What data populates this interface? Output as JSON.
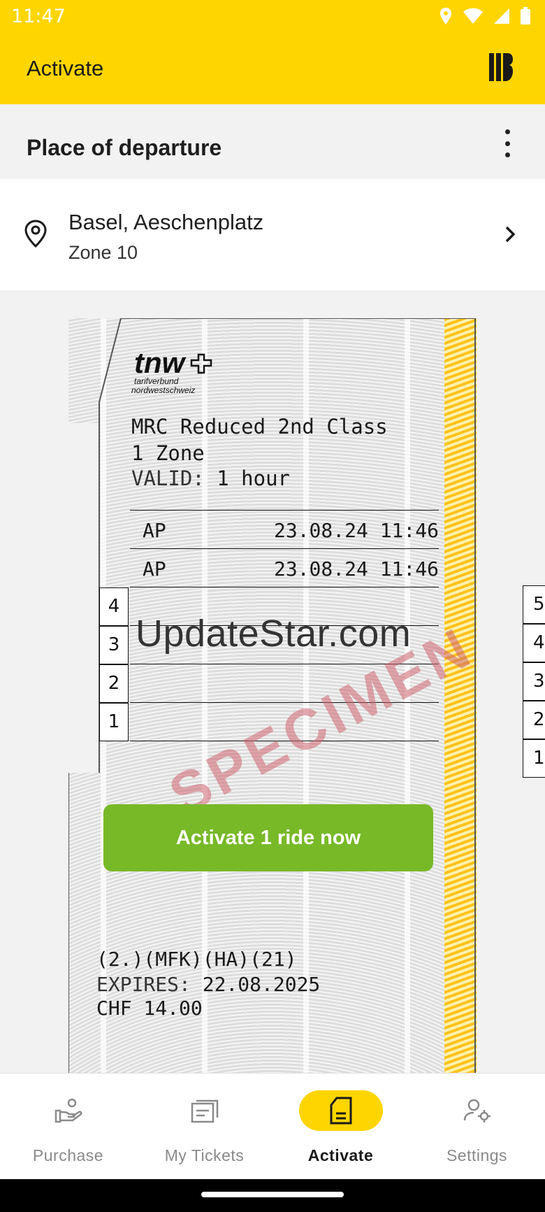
{
  "status_bar": {
    "time": "11:47"
  },
  "app_bar": {
    "title": "Activate"
  },
  "section": {
    "title": "Place of departure"
  },
  "location": {
    "name": "Basel, Aeschenplatz",
    "zone": "Zone 10"
  },
  "ticket": {
    "logo_text": "tnw",
    "logo_sub1": "tarifverbund",
    "logo_sub2": "nordwestschweiz",
    "product": "MRC Reduced 2nd Class",
    "zones": "1 Zone",
    "valid_label": "VALID:",
    "valid_value": "1 hour",
    "stamps": [
      {
        "code": "AP",
        "datetime": "23.08.24 11:46"
      },
      {
        "code": "AP",
        "datetime": "23.08.24 11:46"
      }
    ],
    "slots": [
      "4",
      "3",
      "2",
      "1"
    ],
    "watermark": "UpdateStar.com",
    "specimen": "SPECIMEN",
    "activate_label": "Activate 1 ride now",
    "codes": "(2.)(MFK)(HA)(21)",
    "expires_label": "EXPIRES:",
    "expires_value": "22.08.2025",
    "price": "CHF 14.00"
  },
  "next_ticket": {
    "slots": [
      "5",
      "4",
      "3",
      "2",
      "1"
    ]
  },
  "bottom_nav": [
    {
      "label": "Purchase",
      "icon": "purchase-hand-icon",
      "active": false
    },
    {
      "label": "My Tickets",
      "icon": "tickets-icon",
      "active": false
    },
    {
      "label": "Activate",
      "icon": "activate-ticket-icon",
      "active": true
    },
    {
      "label": "Settings",
      "icon": "user-settings-icon",
      "active": false
    }
  ],
  "colors": {
    "brand_yellow": "#ffd500",
    "activate_green": "#78b928",
    "hologram": "#ffc21a"
  }
}
